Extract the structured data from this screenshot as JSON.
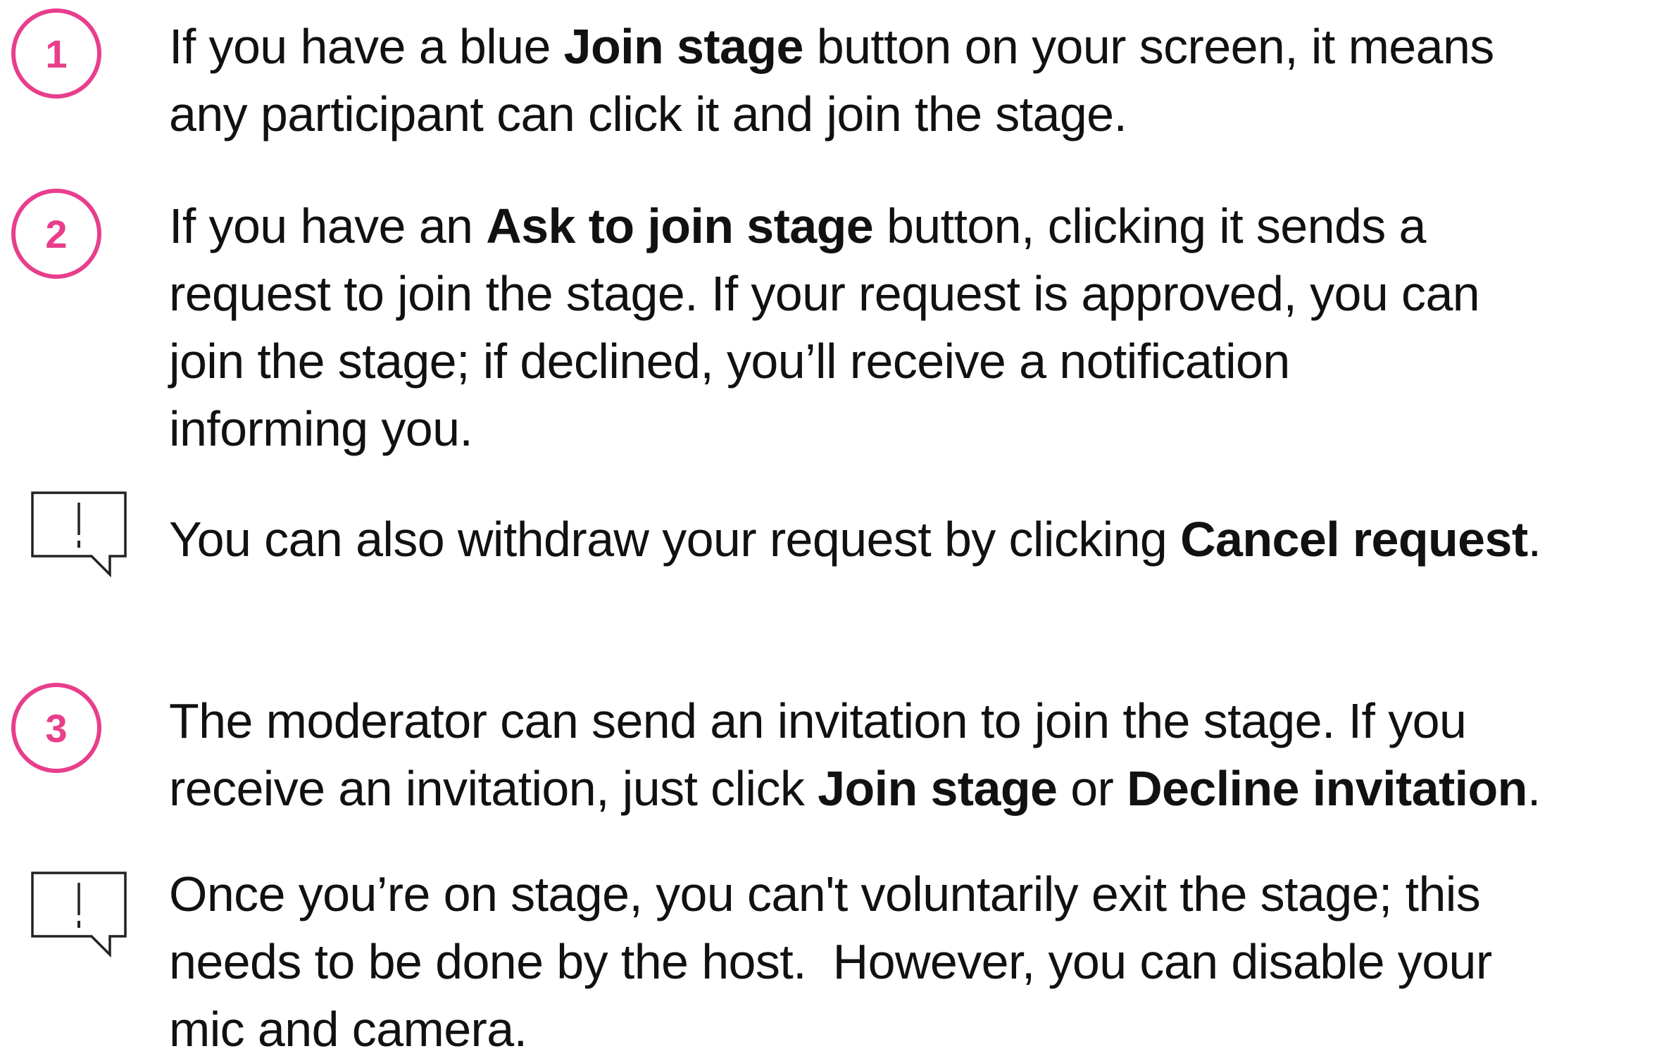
{
  "steps": [
    {
      "number": "1",
      "lines": [
        [
          {
            "t": "If you have a blue "
          },
          {
            "t": "Join stage",
            "b": true
          },
          {
            "t": " button on your screen, it means"
          }
        ],
        [
          {
            "t": "any participant can click it and join the stage."
          }
        ]
      ]
    },
    {
      "number": "2",
      "lines": [
        [
          {
            "t": "If you have an "
          },
          {
            "t": "Ask to join stage",
            "b": true
          },
          {
            "t": " button, clicking it sends a"
          }
        ],
        [
          {
            "t": "request to join the stage. If your request is approved, you can"
          }
        ],
        [
          {
            "t": "join the stage; if declined, you’ll receive a notification"
          }
        ],
        [
          {
            "t": "informing you."
          }
        ]
      ]
    },
    {
      "note": true,
      "icon": "alert-speech-bubble-icon",
      "lines": [
        [
          {
            "t": "You can also withdraw your request by clicking "
          },
          {
            "t": "Cancel request",
            "b": true
          },
          {
            "t": "."
          }
        ]
      ]
    },
    {
      "number": "3",
      "lines": [
        [
          {
            "t": "The moderator can send an invitation to join the stage. If you"
          }
        ],
        [
          {
            "t": "receive an invitation, just click "
          },
          {
            "t": "Join stage",
            "b": true
          },
          {
            "t": " or "
          },
          {
            "t": "Decline invitation",
            "b": true
          },
          {
            "t": "."
          }
        ]
      ]
    },
    {
      "note": true,
      "icon": "alert-speech-bubble-icon",
      "lines": [
        [
          {
            "t": "Once you’re on stage, you can't voluntarily exit the stage; this"
          }
        ],
        [
          {
            "t": "needs to be done by the host.  However, you can disable your"
          }
        ],
        [
          {
            "t": "mic and camera."
          }
        ]
      ]
    }
  ],
  "colors": {
    "accent": "#e83e8c",
    "text": "#111111",
    "icon_stroke": "#222222"
  }
}
